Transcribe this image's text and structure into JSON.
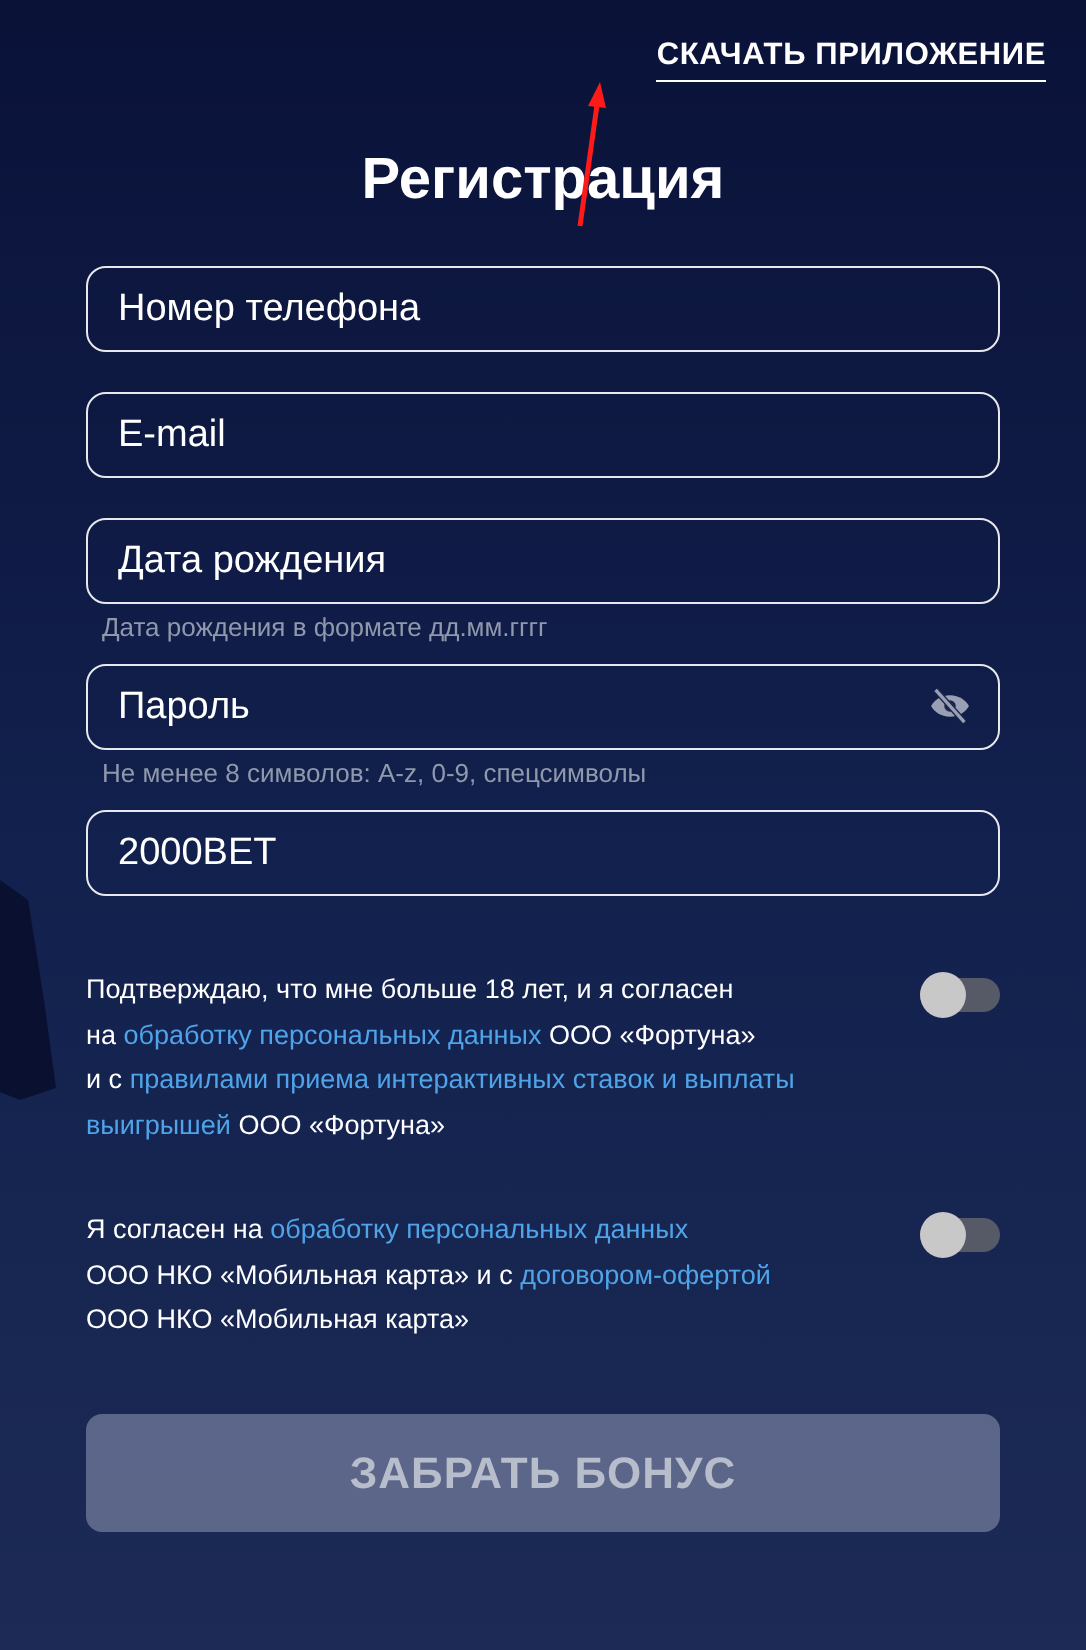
{
  "header": {
    "download_link": "СКАЧАТЬ ПРИЛОЖЕНИЕ"
  },
  "title": "Регистрация",
  "fields": [
    {
      "kind": "text",
      "placeholder": "Номер телефона"
    },
    {
      "kind": "text",
      "placeholder": "E-mail"
    },
    {
      "kind": "text",
      "placeholder": "Дата рождения",
      "hint": "Дата рождения в формате дд.мм.гггг"
    },
    {
      "kind": "password",
      "placeholder": "Пароль",
      "hint": "Не менее 8 символов: A-z, 0-9, спецсимволы"
    },
    {
      "kind": "text",
      "value": "2000BET"
    }
  ],
  "consents": [
    {
      "on": false,
      "lines": [
        [
          {
            "text": "Подтверждаю, что мне больше 18 лет, и я согласен",
            "link": false
          }
        ],
        [
          {
            "text": "на",
            "link": false
          },
          {
            "text": "обработку персональных данных",
            "link": true
          },
          {
            "text": "ООО «Фортуна»",
            "link": false
          }
        ],
        [
          {
            "text": "и с",
            "link": false
          },
          {
            "text": "правилами приема интерактивных ставок и выплаты",
            "link": true
          }
        ],
        [
          {
            "text": "выигрышей",
            "link": true
          },
          {
            "text": "ООО «Фортуна»",
            "link": false
          }
        ]
      ]
    },
    {
      "on": false,
      "lines": [
        [
          {
            "text": "Я согласен на",
            "link": false
          },
          {
            "text": "обработку персональных данных",
            "link": true
          }
        ],
        [
          {
            "text": "ООО НКО «Мобильная карта» и с",
            "link": false
          },
          {
            "text": "договором-офертой",
            "link": true
          }
        ],
        [
          {
            "text": "ООО НКО «Мобильная карта»",
            "link": false
          }
        ]
      ]
    }
  ],
  "submit": {
    "label": "ЗАБРАТЬ БОНУС",
    "disabled": true
  }
}
